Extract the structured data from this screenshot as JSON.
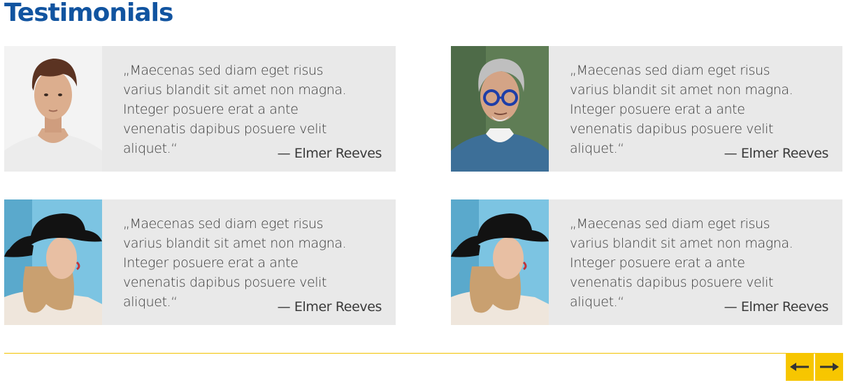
{
  "page": {
    "title": "Testimonials"
  },
  "testimonials": [
    {
      "photo_icon": "young-man-portrait",
      "quote": "„Maecenas sed diam eget risus varius blandit sit amet non magna. Integer posuere erat a ante venenatis dapibus posuere velit aliquet.“",
      "author": "— Elmer Reeves"
    },
    {
      "photo_icon": "older-man-glasses-portrait",
      "quote": "„Maecenas sed diam eget risus varius blandit sit amet non magna. Integer posuere erat a ante venenatis dapibus posuere velit aliquet.“",
      "author": "— Elmer Reeves"
    },
    {
      "photo_icon": "woman-black-hat-portrait",
      "quote": "„Maecenas sed diam eget risus varius blandit sit amet non magna. Integer posuere erat a ante venenatis dapibus posuere velit aliquet.“",
      "author": "— Elmer Reeves"
    },
    {
      "photo_icon": "woman-black-hat-portrait",
      "quote": "„Maecenas sed diam eget risus varius blandit sit amet non magna. Integer posuere erat a ante venenatis dapibus posuere velit aliquet.“",
      "author": "— Elmer Reeves"
    }
  ],
  "navigation": {
    "prev_icon": "arrow-left-icon",
    "next_icon": "arrow-right-icon"
  },
  "colors": {
    "title": "#1154a0",
    "card_background": "#e9e9e9",
    "accent": "#f7c600",
    "text": "#3a3a3a"
  }
}
